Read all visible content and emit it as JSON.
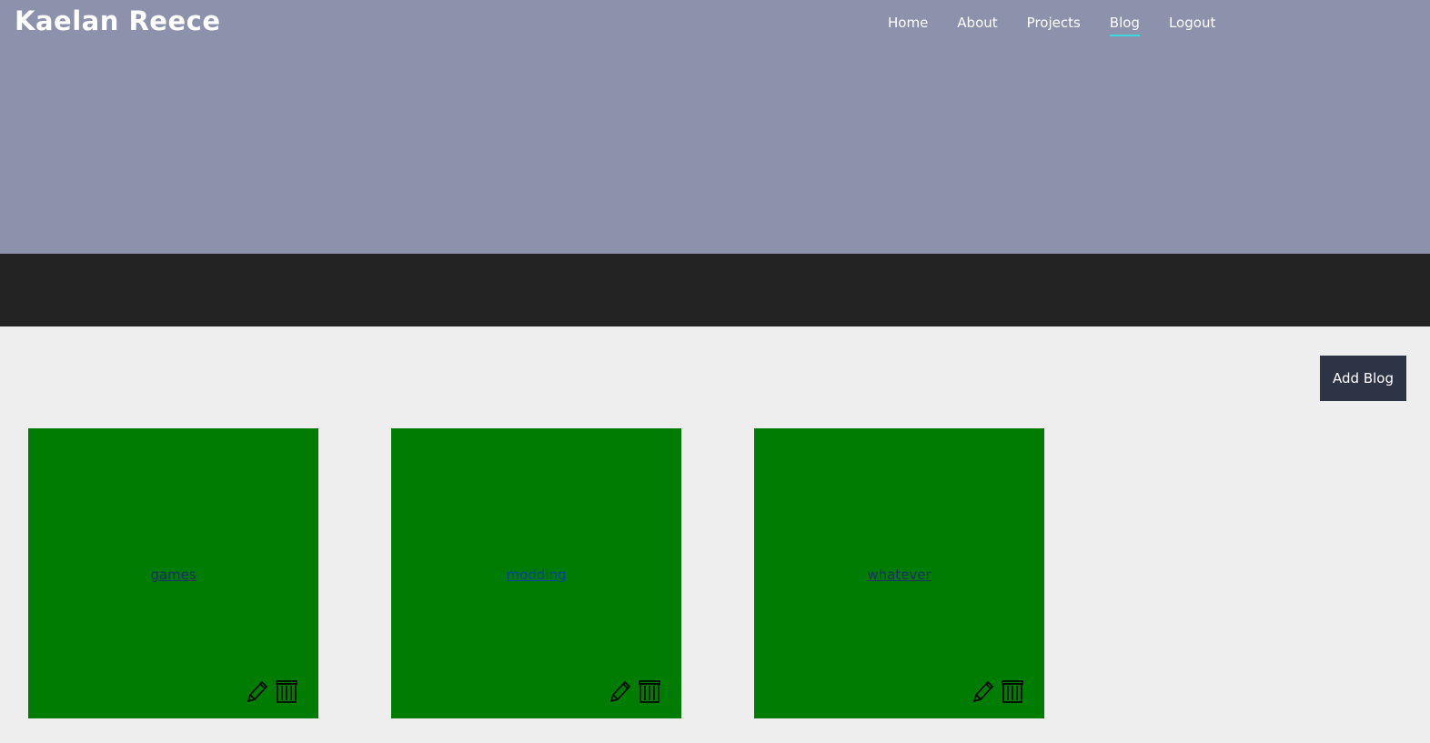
{
  "header": {
    "site_title": "Kaelan Reece",
    "nav": [
      {
        "label": "Home"
      },
      {
        "label": "About"
      },
      {
        "label": "Projects"
      },
      {
        "label": "Blog"
      },
      {
        "label": "Logout"
      }
    ],
    "active_nav": "Blog"
  },
  "main": {
    "add_button_label": "Add Blog",
    "blogs": [
      {
        "title": "games",
        "edit_icon": "pencil-icon",
        "delete_icon": "trash-icon"
      },
      {
        "title": "modding",
        "edit_icon": "pencil-icon",
        "delete_icon": "trash-icon"
      },
      {
        "title": "whatever",
        "edit_icon": "pencil-icon",
        "delete_icon": "trash-icon"
      }
    ]
  },
  "colors": {
    "hero": "#8c91ac",
    "dark_band": "#232323",
    "card": "#007d00",
    "button": "#2d3446",
    "nav_underline": "#3ad8e0"
  }
}
